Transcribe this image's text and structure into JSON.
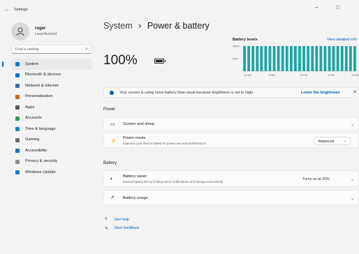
{
  "window": {
    "back_glyph": "←",
    "title": "Settings",
    "minimize_glyph": "–",
    "maximize_glyph": "□"
  },
  "sidebar": {
    "user": {
      "name": "roger",
      "account_type": "Local Account"
    },
    "search": {
      "placeholder": "Find a setting"
    },
    "items": [
      {
        "label": "System",
        "icon": "monitor-icon",
        "color": "#0078d4",
        "active": true
      },
      {
        "label": "Bluetooth & devices",
        "icon": "bluetooth-icon",
        "color": "#0078d4"
      },
      {
        "label": "Network & internet",
        "icon": "network-icon",
        "color": "#3e6aa8"
      },
      {
        "label": "Personalization",
        "icon": "brush-icon",
        "color": "#c26b1f"
      },
      {
        "label": "Apps",
        "icon": "apps-icon",
        "color": "#5a5a5a"
      },
      {
        "label": "Accounts",
        "icon": "person-icon",
        "color": "#2b9a5a"
      },
      {
        "label": "Time & language",
        "icon": "globe-clock-icon",
        "color": "#1b7fc4"
      },
      {
        "label": "Gaming",
        "icon": "gamepad-icon",
        "color": "#6b6b6b"
      },
      {
        "label": "Accessibility",
        "icon": "accessibility-icon",
        "color": "#1f6fc5"
      },
      {
        "label": "Privacy & security",
        "icon": "shield-icon",
        "color": "#8a8a8a"
      },
      {
        "label": "Windows Update",
        "icon": "update-icon",
        "color": "#1f78d1"
      }
    ]
  },
  "main": {
    "breadcrumb_parent": "System",
    "breadcrumb_separator": "›",
    "breadcrumb_current": "Power & battery",
    "battery_percent": "100%",
    "battery_levels": {
      "title": "Battery levels",
      "link": "View detailed info"
    },
    "banner": {
      "text": "Your screen is using more battery than usual because brightness is set to High.",
      "action": "Lower the brightness",
      "close_glyph": "✕"
    },
    "power_section": {
      "label": "Power",
      "screen_and_sleep": {
        "title": "Screen and sleep"
      },
      "power_mode": {
        "title": "Power mode",
        "subtitle": "Optimize your device based on power use and performance",
        "value": "Balanced"
      }
    },
    "battery_section": {
      "label": "Battery",
      "battery_saver": {
        "title": "Battery saver",
        "subtitle": "Extend battery life by limiting some notifications and background activity",
        "value": "Turns on at 20%"
      },
      "battery_usage": {
        "title": "Battery usage"
      }
    },
    "help_links": {
      "get_help": "Get help",
      "give_feedback": "Give feedback"
    }
  },
  "chart_data": {
    "type": "bar",
    "title": "Battery levels",
    "y_tick_labels": [
      "100%",
      "50%"
    ],
    "x_tick_labels": [
      "12 AM",
      "6 AM",
      "12 PM",
      "6 PM",
      "12 AM"
    ],
    "ylim": [
      0,
      100
    ],
    "bar_color": "#1aa6a6",
    "values": [
      100,
      100,
      100,
      100,
      100,
      100,
      100,
      100,
      100,
      100,
      100,
      100,
      100,
      100,
      100,
      100,
      100,
      100,
      100,
      100,
      100,
      100,
      100,
      100,
      100,
      100,
      100
    ],
    "grid": true
  }
}
